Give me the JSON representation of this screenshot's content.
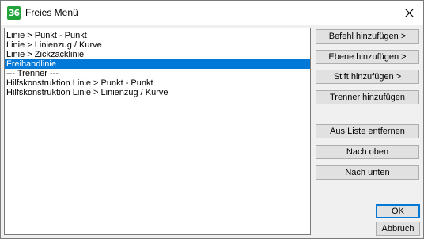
{
  "window": {
    "title": "Freies Menü",
    "app_icon_text": "36"
  },
  "list": {
    "items": [
      "Linie > Punkt - Punkt",
      "Linie > Linienzug / Kurve",
      "Linie > Zickzacklinie",
      "Freihandlinie",
      "--- Trenner ---",
      "Hilfskonstruktion Linie > Punkt - Punkt",
      "Hilfskonstruktion Linie > Linienzug / Kurve"
    ],
    "selected_index": 3
  },
  "buttons": {
    "add_command": "Befehl hinzufügen >",
    "add_layer": "Ebene hinzufügen >",
    "add_pen": "Stift hinzufügen >",
    "add_separator": "Trenner hinzufügen",
    "remove_from_list": "Aus Liste entfernen",
    "move_up": "Nach oben",
    "move_down": "Nach unten",
    "ok": "OK",
    "cancel": "Abbruch"
  }
}
